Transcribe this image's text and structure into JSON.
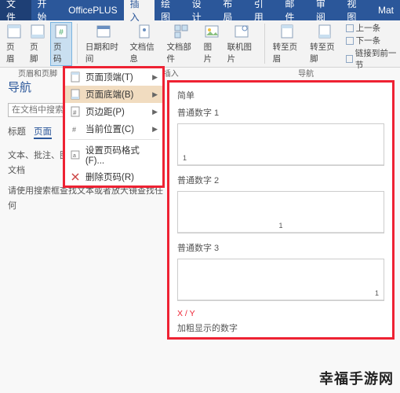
{
  "tabs": {
    "file": "文件",
    "home": "开始",
    "officeplus": "OfficePLUS",
    "insert": "插入",
    "draw": "绘图",
    "design": "设计",
    "layout": "布局",
    "references": "引用",
    "mailings": "邮件",
    "review": "审阅",
    "view": "视图",
    "mat": "Mat"
  },
  "ribbon": {
    "header": {
      "label": "页眉"
    },
    "footer": {
      "label": "页脚"
    },
    "pagenum": {
      "label": "页码"
    },
    "datetime": {
      "label": "日期和时间"
    },
    "docinfo": {
      "label": "文档信息"
    },
    "docparts": {
      "label": "文档部件"
    },
    "picture": {
      "label": "图片"
    },
    "onlinepic": {
      "label": "联机图片"
    },
    "gotoheader": {
      "label": "转至页眉"
    },
    "gotofooter": {
      "label": "转至页脚"
    },
    "group1": "页眉和页脚",
    "group2": "插入",
    "group3": "导航",
    "nav_prev": "上一条",
    "nav_next": "下一条",
    "nav_link": "链接到前一节"
  },
  "leftpane": {
    "title": "导航",
    "search_placeholder": "在文档中搜索",
    "tab_headings": "标题",
    "tab_pages": "页面",
    "desc1": "文本、批注、图片...Word 可以查找您的文档",
    "desc2": "请使用搜索框查找文本或者放大镜查找任何"
  },
  "menu": {
    "top": "页面顶端(T)",
    "bottom": "页面底端(B)",
    "margin": "页边距(P)",
    "current": "当前位置(C)",
    "format": "设置页码格式(F)...",
    "remove": "删除页码(R)"
  },
  "fly": {
    "simple": "简单",
    "plain1": "普通数字 1",
    "plain2": "普通数字 2",
    "plain3": "普通数字 3",
    "xy": "X / Y",
    "bold": "加粗显示的数字"
  },
  "watermark": "幸福手游网"
}
